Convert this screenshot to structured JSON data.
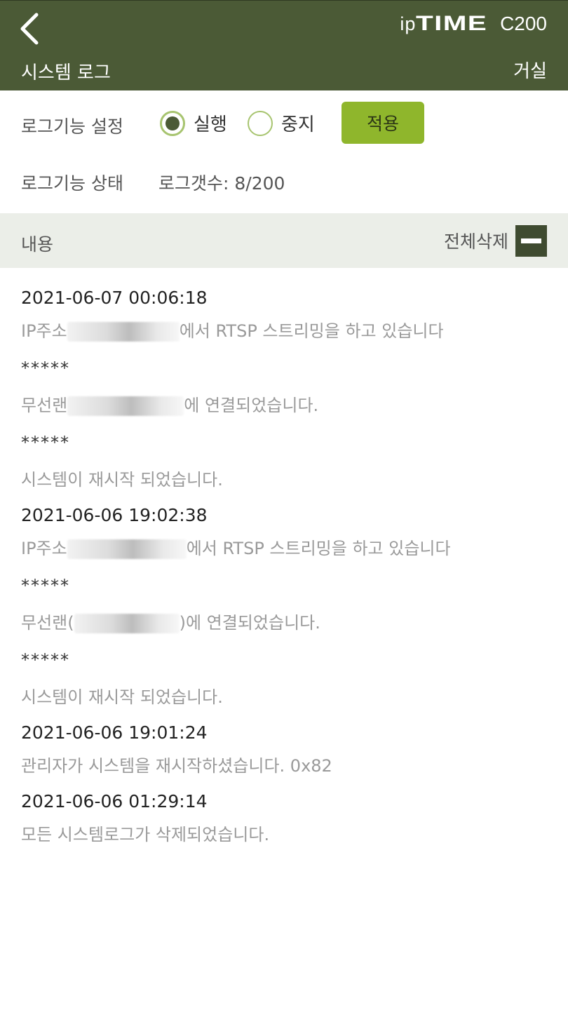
{
  "header": {
    "brand_prefix": "ip",
    "brand_main": "TIME",
    "model": "C200",
    "page_title": "시스템 로그",
    "camera_name": "거실"
  },
  "log_setting": {
    "label": "로그기능 설정",
    "options": [
      {
        "label": "실행",
        "selected": true
      },
      {
        "label": "중지",
        "selected": false
      }
    ],
    "apply_label": "적용"
  },
  "log_status": {
    "label": "로그기능 상태",
    "value": "로그갯수: 8/200"
  },
  "list_header": {
    "content_label": "내용",
    "delete_all_label": "전체삭제"
  },
  "logs": [
    {
      "time": "2021-06-07 00:06:18",
      "lines": [
        {
          "pre": "IP주소",
          "post": "에서 RTSP 스트리밍을 하고 있습니다",
          "stars": false
        },
        {
          "text": "*****",
          "stars": true
        },
        {
          "pre": "무선랜",
          "post": "에  연결되었습니다.",
          "stars": false
        },
        {
          "text": "*****",
          "stars": true
        },
        {
          "text": "시스템이 재시작 되었습니다.",
          "stars": false
        }
      ]
    },
    {
      "time": "2021-06-06 19:02:38",
      "lines": [
        {
          "pre": "IP주소",
          "post": "에서 RTSP 스트리밍을 하고 있습니다",
          "stars": false
        },
        {
          "text": "*****",
          "stars": true
        },
        {
          "pre": "무선랜(",
          "post": ")에  연결되었습니다.",
          "stars": false
        },
        {
          "text": "*****",
          "stars": true
        },
        {
          "text": "시스템이 재시작 되었습니다.",
          "stars": false
        }
      ]
    },
    {
      "time": "2021-06-06 19:01:24",
      "lines": [
        {
          "text": "관리자가 시스템을 재시작하셨습니다. 0x82",
          "stars": false
        }
      ]
    },
    {
      "time": "2021-06-06 01:29:14",
      "lines": [
        {
          "text": "모든 시스템로그가 삭제되었습니다.",
          "stars": false
        }
      ]
    }
  ],
  "colors": {
    "header_bg": "#4b5a36",
    "accent_green": "#8fb62c",
    "radio_ring": "#a7c46f",
    "list_header_bg": "#ebeee8"
  }
}
